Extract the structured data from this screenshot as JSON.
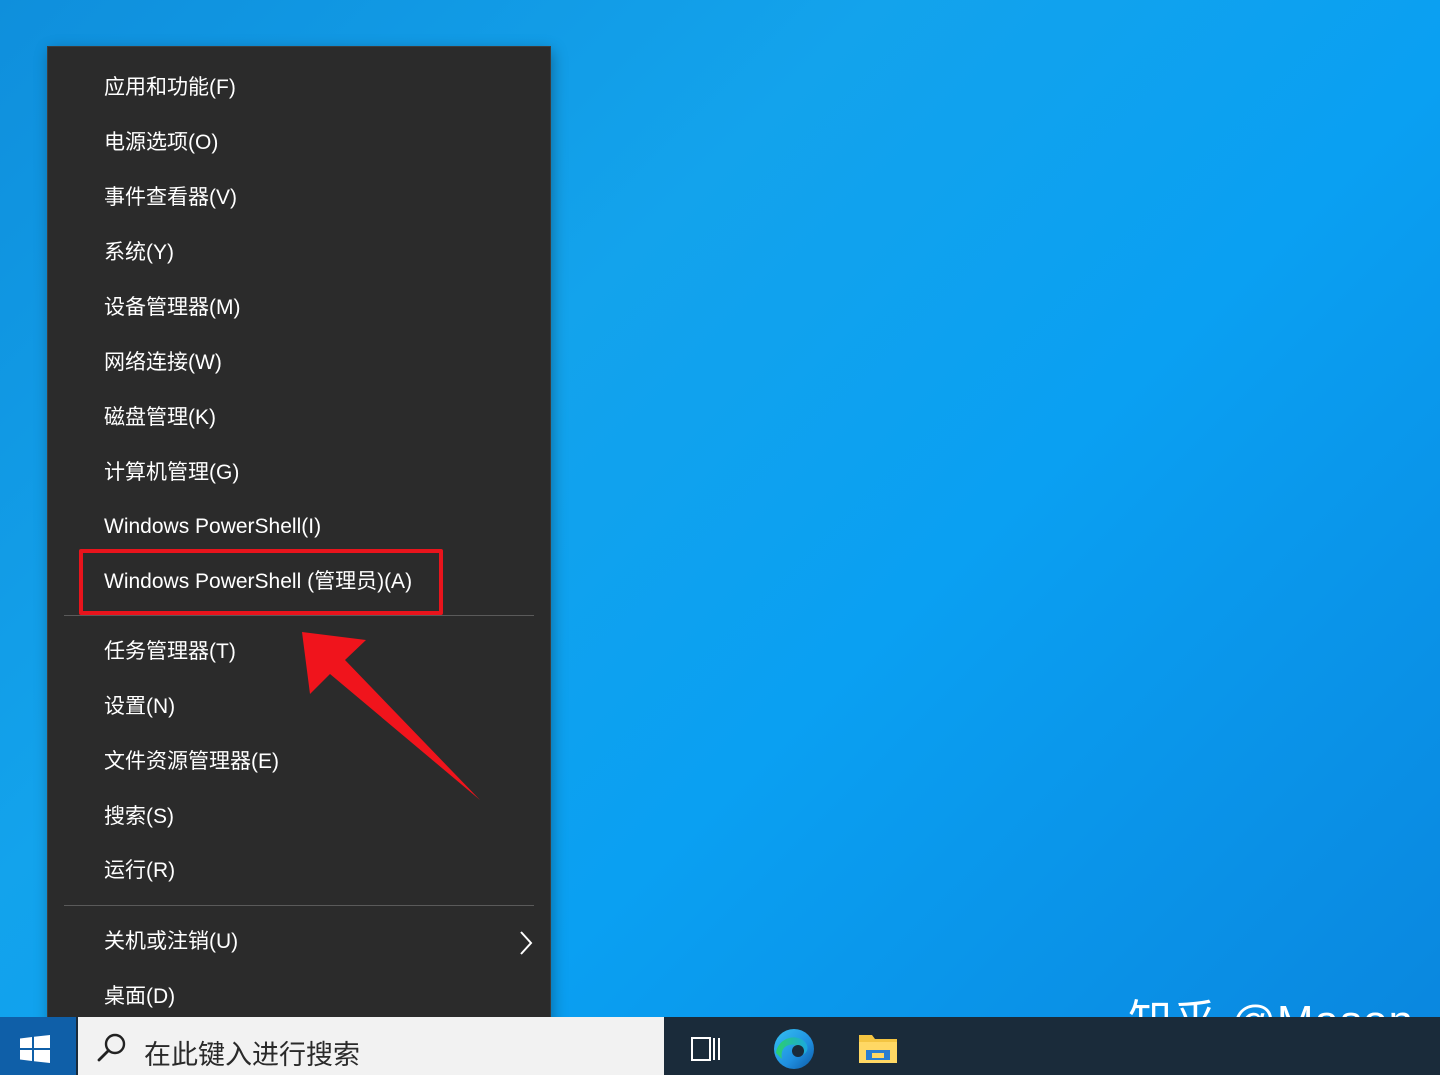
{
  "menu": {
    "items": [
      {
        "label": "应用和功能(F)"
      },
      {
        "label": "电源选项(O)"
      },
      {
        "label": "事件查看器(V)"
      },
      {
        "label": "系统(Y)"
      },
      {
        "label": "设备管理器(M)"
      },
      {
        "label": "网络连接(W)"
      },
      {
        "label": "磁盘管理(K)"
      },
      {
        "label": "计算机管理(G)"
      },
      {
        "label": "Windows PowerShell(I)"
      },
      {
        "label": "Windows PowerShell (管理员)(A)"
      },
      {
        "label": "任务管理器(T)"
      },
      {
        "label": "设置(N)"
      },
      {
        "label": "文件资源管理器(E)"
      },
      {
        "label": "搜索(S)"
      },
      {
        "label": "运行(R)"
      },
      {
        "label": "关机或注销(U)"
      },
      {
        "label": "桌面(D)"
      }
    ],
    "highlighted": "Windows PowerShell (管理员)(A)"
  },
  "taskbar": {
    "search_placeholder": "在此键入进行搜索",
    "icons": [
      "windows-start-icon",
      "search-icon",
      "task-view-icon",
      "edge-icon",
      "file-explorer-icon"
    ]
  },
  "watermark": "知乎 @Mason",
  "colors": {
    "desktop": "#0aa0f2",
    "menu_bg": "#2b2b2b",
    "highlight": "#e8141c",
    "taskbar": "#1a2b3a"
  }
}
